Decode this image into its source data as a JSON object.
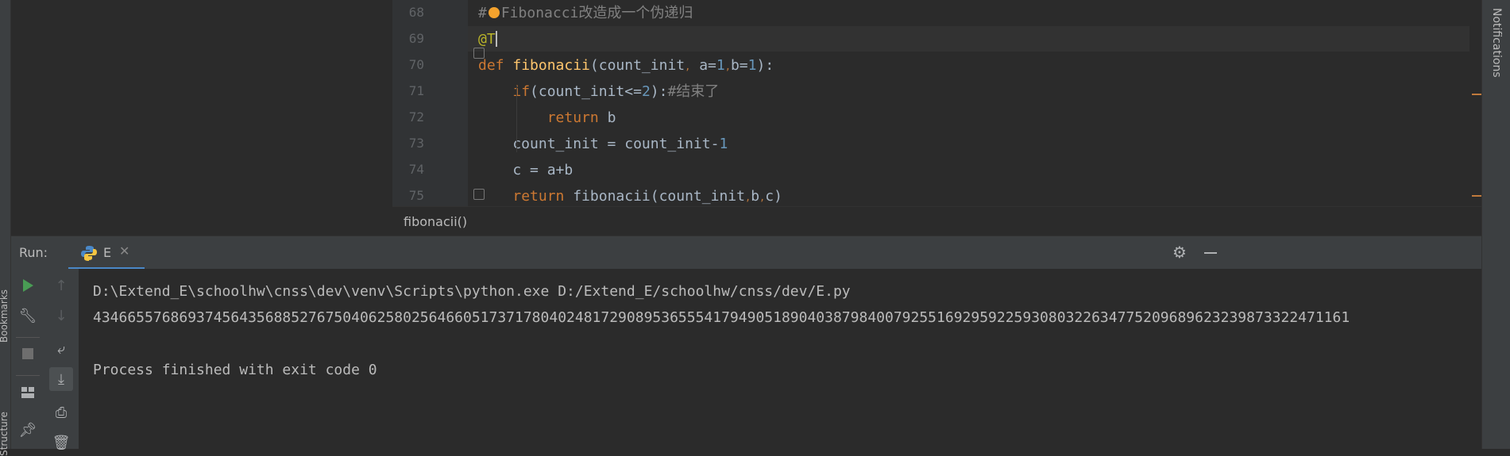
{
  "left_strip": {
    "bookmarks_label": "Bookmarks",
    "structure_label": "Structure"
  },
  "right_strip": {
    "notifications_label": "Notifications"
  },
  "editor": {
    "lines": [
      {
        "num": "68",
        "parts": [
          [
            "cm",
            "#"
          ],
          [
            "bulb",
            ""
          ],
          [
            "cm",
            "Fibonacci改造成一个伪递归"
          ]
        ]
      },
      {
        "num": "69",
        "parts": [
          [
            "deco",
            "@T"
          ]
        ]
      },
      {
        "num": "70",
        "parts": [
          [
            "kw",
            "def "
          ],
          [
            "fn",
            "fibonacii"
          ],
          [
            "plain",
            "(count_init"
          ],
          [
            "hint",
            ","
          ],
          [
            "plain",
            " a="
          ],
          [
            "num",
            "1"
          ],
          [
            "hint",
            ","
          ],
          [
            "plain",
            "b="
          ],
          [
            "num",
            "1"
          ],
          [
            "plain",
            "):"
          ]
        ]
      },
      {
        "num": "71",
        "parts": [
          [
            "plain",
            "    "
          ],
          [
            "kw",
            "if"
          ],
          [
            "plain",
            "(count_init<="
          ],
          [
            "num",
            "2"
          ],
          [
            "plain",
            "):"
          ],
          [
            "cm",
            "#结束了"
          ]
        ]
      },
      {
        "num": "72",
        "parts": [
          [
            "plain",
            "        "
          ],
          [
            "kw",
            "return "
          ],
          [
            "plain",
            "b"
          ]
        ]
      },
      {
        "num": "73",
        "parts": [
          [
            "plain",
            "    count_init = count_init-"
          ],
          [
            "num",
            "1"
          ]
        ]
      },
      {
        "num": "74",
        "parts": [
          [
            "plain",
            "    c = a+b"
          ]
        ]
      },
      {
        "num": "75",
        "parts": [
          [
            "plain",
            "    "
          ],
          [
            "kw",
            "return "
          ],
          [
            "plain",
            "fibonacii(count_init"
          ],
          [
            "hint",
            ","
          ],
          [
            "plain",
            "b"
          ],
          [
            "hint",
            ","
          ],
          [
            "plain",
            "c)"
          ]
        ]
      }
    ],
    "breadcrumb": "fibonacii()"
  },
  "run": {
    "label": "Run:",
    "tab_name": "E",
    "console": {
      "command": "D:\\Extend_E\\schoolhw\\cnss\\dev\\venv\\Scripts\\python.exe D:/Extend_E/schoolhw/cnss/dev/E.py",
      "output": "43466557686937456435688527675040625802564660517371780402481729089536555417949051890403879840079255169295922593080322634775209689623239873322471161",
      "exit": "Process finished with exit code 0"
    }
  },
  "colors": {
    "keyword": "#cc7832",
    "function": "#ffc66d",
    "number": "#6897bb",
    "comment": "#808080",
    "decorator": "#bbb529",
    "run_green": "#499c54"
  }
}
